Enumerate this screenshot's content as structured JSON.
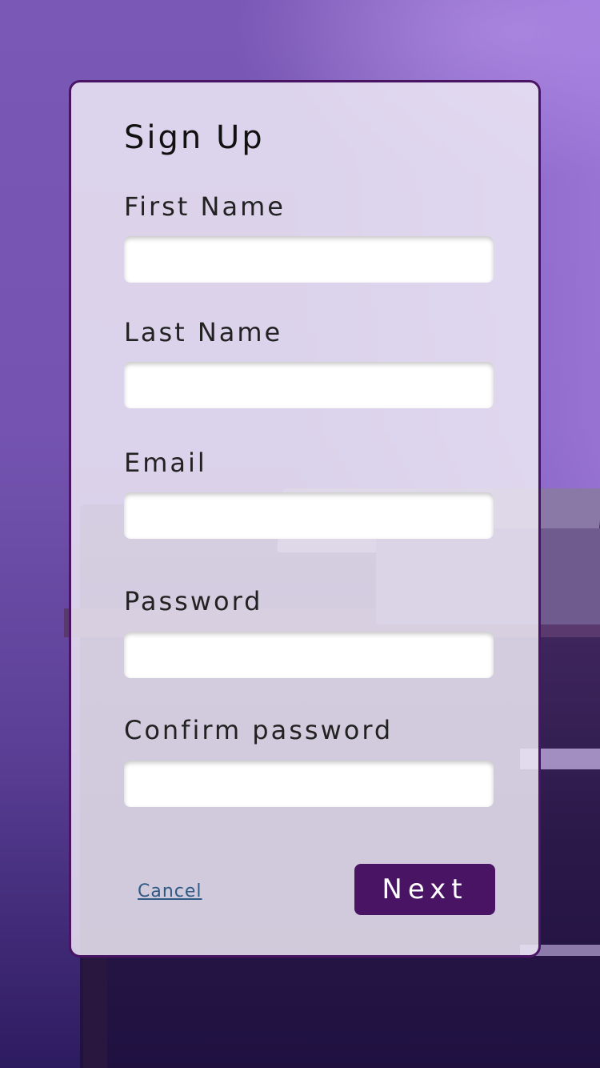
{
  "form": {
    "title": "Sign Up",
    "fields": [
      {
        "label": "First Name",
        "value": "",
        "placeholder": ""
      },
      {
        "label": "Last Name",
        "value": "",
        "placeholder": ""
      },
      {
        "label": "Email",
        "value": "",
        "placeholder": ""
      },
      {
        "label": "Password",
        "value": "",
        "placeholder": ""
      },
      {
        "label": "Confirm password",
        "value": "",
        "placeholder": ""
      }
    ],
    "cancel_label": "Cancel",
    "next_label": "Next"
  },
  "colors": {
    "accent": "#4a1465",
    "link": "#2f5a86",
    "card_background": "#ece8f4"
  }
}
